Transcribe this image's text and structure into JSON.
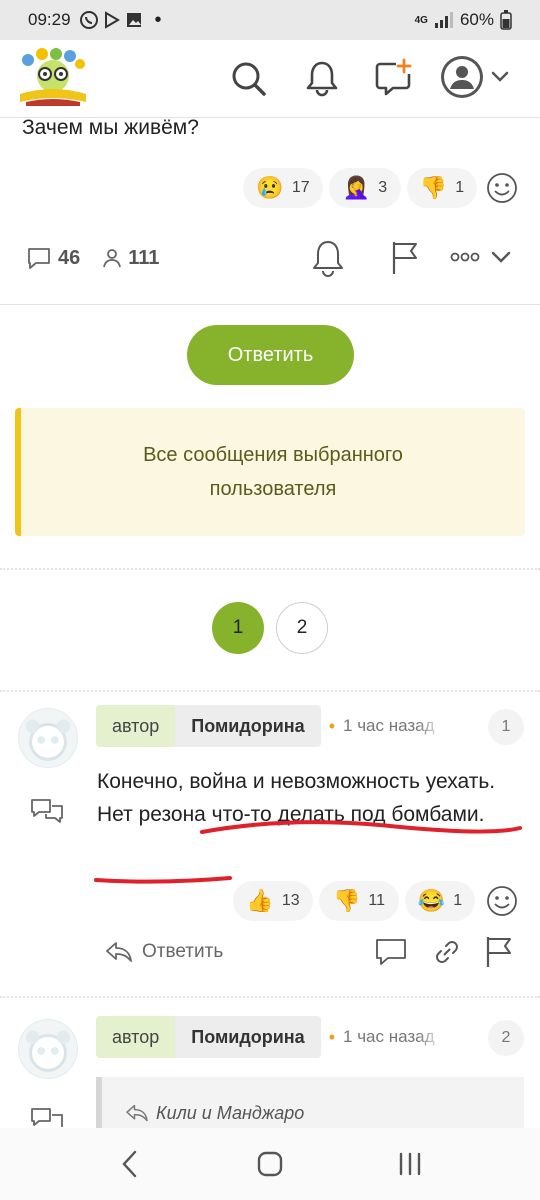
{
  "status_bar": {
    "time": "09:29",
    "network": "4G",
    "battery": "60%"
  },
  "toolbar": {
    "icons": [
      "search-icon",
      "bell-icon",
      "new-topic-icon",
      "avatar-icon",
      "chevron-down-icon"
    ]
  },
  "post": {
    "title": "Зачем мы живём?",
    "reactions": [
      {
        "emoji": "😢",
        "count": "17"
      },
      {
        "emoji": "🤦‍♀️",
        "count": "3"
      },
      {
        "emoji": "👎",
        "count": "1"
      }
    ],
    "comments_count": "46",
    "users_count": "111",
    "reply_button": "Ответить",
    "notice": "Все сообщения выбранного пользователя"
  },
  "pagination": {
    "pages": [
      "1",
      "2"
    ],
    "current": "1"
  },
  "comments": [
    {
      "author_tag": "автор",
      "author_name": "Помидорина",
      "time": "1 час назад",
      "number": "1",
      "text": "Конечно, война и невозможность уехать. Нет резона что-то делать под бомбами.",
      "reactions": [
        {
          "emoji": "👍",
          "count": "13"
        },
        {
          "emoji": "👎",
          "count": "11"
        },
        {
          "emoji": "😂",
          "count": "1"
        }
      ],
      "reply_label": "Ответить"
    },
    {
      "author_tag": "автор",
      "author_name": "Помидорина",
      "time": "1 час назад",
      "number": "2",
      "quote_author": "Кили и Манджаро"
    }
  ],
  "colors": {
    "accent_green": "#86b32b",
    "notice_bg": "#fcf7e1",
    "notice_border": "#f0c419",
    "annotation_red": "#e0202a"
  }
}
